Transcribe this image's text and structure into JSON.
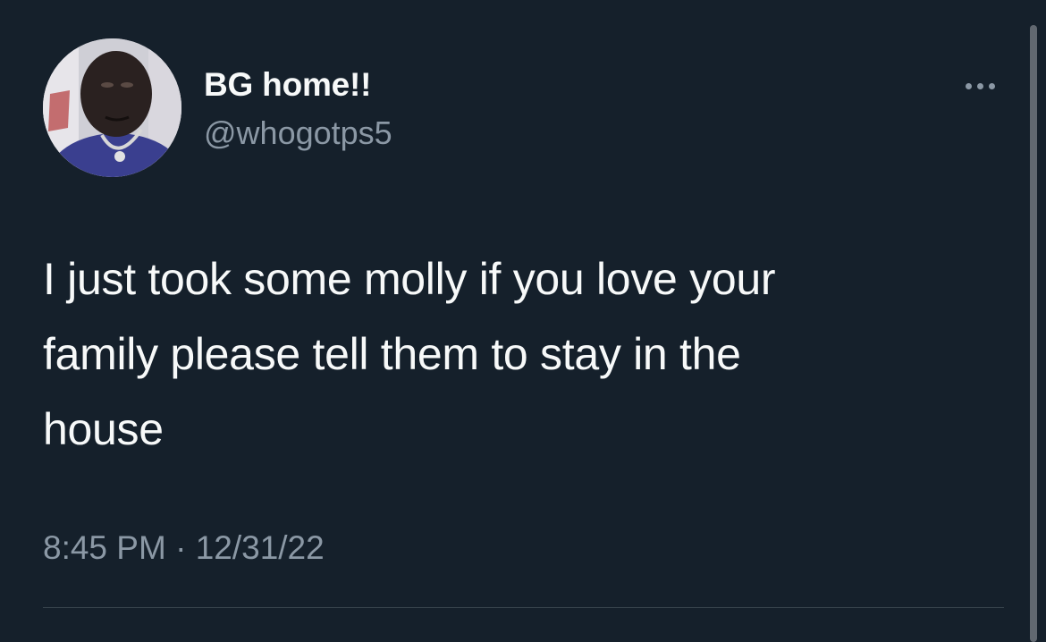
{
  "tweet": {
    "author": {
      "display_name": "BG home!!",
      "handle": "@whogotps5",
      "avatar_icon": "user-avatar-photo"
    },
    "more_icon": "ellipsis-icon",
    "text_lines": [
      "I just took some molly if you love your",
      "family please tell them to stay in the",
      "house"
    ],
    "timestamp": {
      "time": "8:45 PM",
      "separator": "·",
      "date": "12/31/22"
    }
  },
  "colors": {
    "background": "#15202b",
    "primary_text": "#f7f9f9",
    "secondary_text": "#8b98a5",
    "divider": "#38444d"
  }
}
